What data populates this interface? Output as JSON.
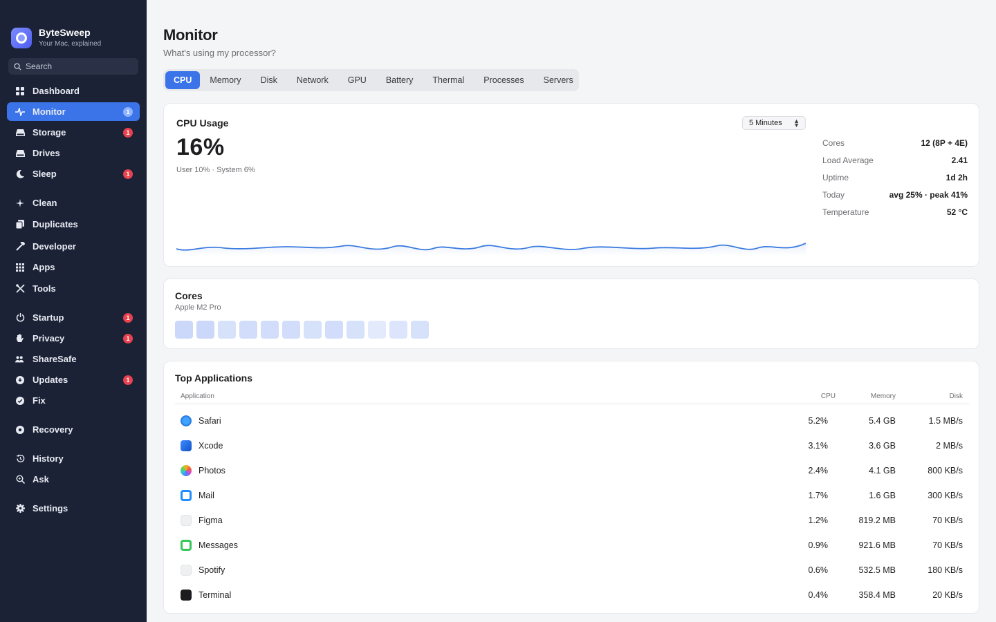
{
  "app": {
    "name": "ByteSweep",
    "tagline": "Your Mac, explained"
  },
  "search": {
    "placeholder": "Search"
  },
  "sidebar": {
    "items": [
      {
        "label": "Dashboard",
        "icon": "grid-icon"
      },
      {
        "label": "Monitor",
        "icon": "pulse-icon",
        "badge": "1",
        "active": true
      },
      {
        "label": "Storage",
        "icon": "drive-icon",
        "badge": "1"
      },
      {
        "label": "Drives",
        "icon": "drive-icon"
      },
      {
        "label": "Sleep",
        "icon": "moon-icon",
        "badge": "1"
      },
      {
        "label": "Clean",
        "icon": "sparkle-icon"
      },
      {
        "label": "Duplicates",
        "icon": "documents-icon"
      },
      {
        "label": "Developer",
        "icon": "hammer-icon"
      },
      {
        "label": "Apps",
        "icon": "apps-grid-icon"
      },
      {
        "label": "Tools",
        "icon": "tools-icon"
      },
      {
        "label": "Startup",
        "icon": "power-icon",
        "badge": "1"
      },
      {
        "label": "Privacy",
        "icon": "hand-icon",
        "badge": "1"
      },
      {
        "label": "ShareSafe",
        "icon": "people-icon"
      },
      {
        "label": "Updates",
        "icon": "download-icon",
        "badge": "1"
      },
      {
        "label": "Fix",
        "icon": "check-badge-icon"
      },
      {
        "label": "Recovery",
        "icon": "lifebuoy-icon"
      },
      {
        "label": "History",
        "icon": "history-icon"
      },
      {
        "label": "Ask",
        "icon": "magnify-sparkle-icon"
      },
      {
        "label": "Settings",
        "icon": "gear-icon"
      }
    ]
  },
  "main": {
    "title": "Monitor",
    "subtitle": "What's using my processor?",
    "tabs": [
      "CPU",
      "Memory",
      "Disk",
      "Network",
      "GPU",
      "Battery",
      "Thermal",
      "Processes",
      "Servers"
    ],
    "active_tab": "CPU"
  },
  "cpu": {
    "title": "CPU Usage",
    "usage": "16%",
    "breakdown": "User 10% · System 6%",
    "range": "5 Minutes",
    "stats": [
      {
        "label": "Cores",
        "value": "12 (8P + 4E)"
      },
      {
        "label": "Load Average",
        "value": "2.41"
      },
      {
        "label": "Uptime",
        "value": "1d 2h"
      },
      {
        "label": "Today",
        "value": "avg 25% · peak 41%"
      },
      {
        "label": "Temperature",
        "value": "52 °C"
      }
    ],
    "line_color": "#3b7be0"
  },
  "cores": {
    "title": "Cores",
    "chip": "Apple M2 Pro",
    "loads": [
      0.6,
      0.6,
      0.4,
      0.5,
      0.5,
      0.5,
      0.4,
      0.5,
      0.4,
      0.2,
      0.3,
      0.4
    ]
  },
  "apps": {
    "title": "Top Applications",
    "columns": [
      "Application",
      "CPU",
      "Memory",
      "Disk"
    ],
    "rows": [
      {
        "name": "Safari",
        "cpu": "5.2%",
        "memory": "5.4 GB",
        "disk": "1.5 MB/s",
        "icon": "safari-icon"
      },
      {
        "name": "Xcode",
        "cpu": "3.1%",
        "memory": "3.6 GB",
        "disk": "2 MB/s",
        "icon": "xcode-icon"
      },
      {
        "name": "Photos",
        "cpu": "2.4%",
        "memory": "4.1 GB",
        "disk": "800 KB/s",
        "icon": "photos-icon"
      },
      {
        "name": "Mail",
        "cpu": "1.7%",
        "memory": "1.6 GB",
        "disk": "300 KB/s",
        "icon": "mail-icon"
      },
      {
        "name": "Figma",
        "cpu": "1.2%",
        "memory": "819.2 MB",
        "disk": "70 KB/s",
        "icon": "figma-icon"
      },
      {
        "name": "Messages",
        "cpu": "0.9%",
        "memory": "921.6 MB",
        "disk": "70 KB/s",
        "icon": "messages-icon"
      },
      {
        "name": "Spotify",
        "cpu": "0.6%",
        "memory": "532.5 MB",
        "disk": "180 KB/s",
        "icon": "spotify-icon"
      },
      {
        "name": "Terminal",
        "cpu": "0.4%",
        "memory": "358.4 MB",
        "disk": "20 KB/s",
        "icon": "terminal-icon"
      }
    ]
  }
}
